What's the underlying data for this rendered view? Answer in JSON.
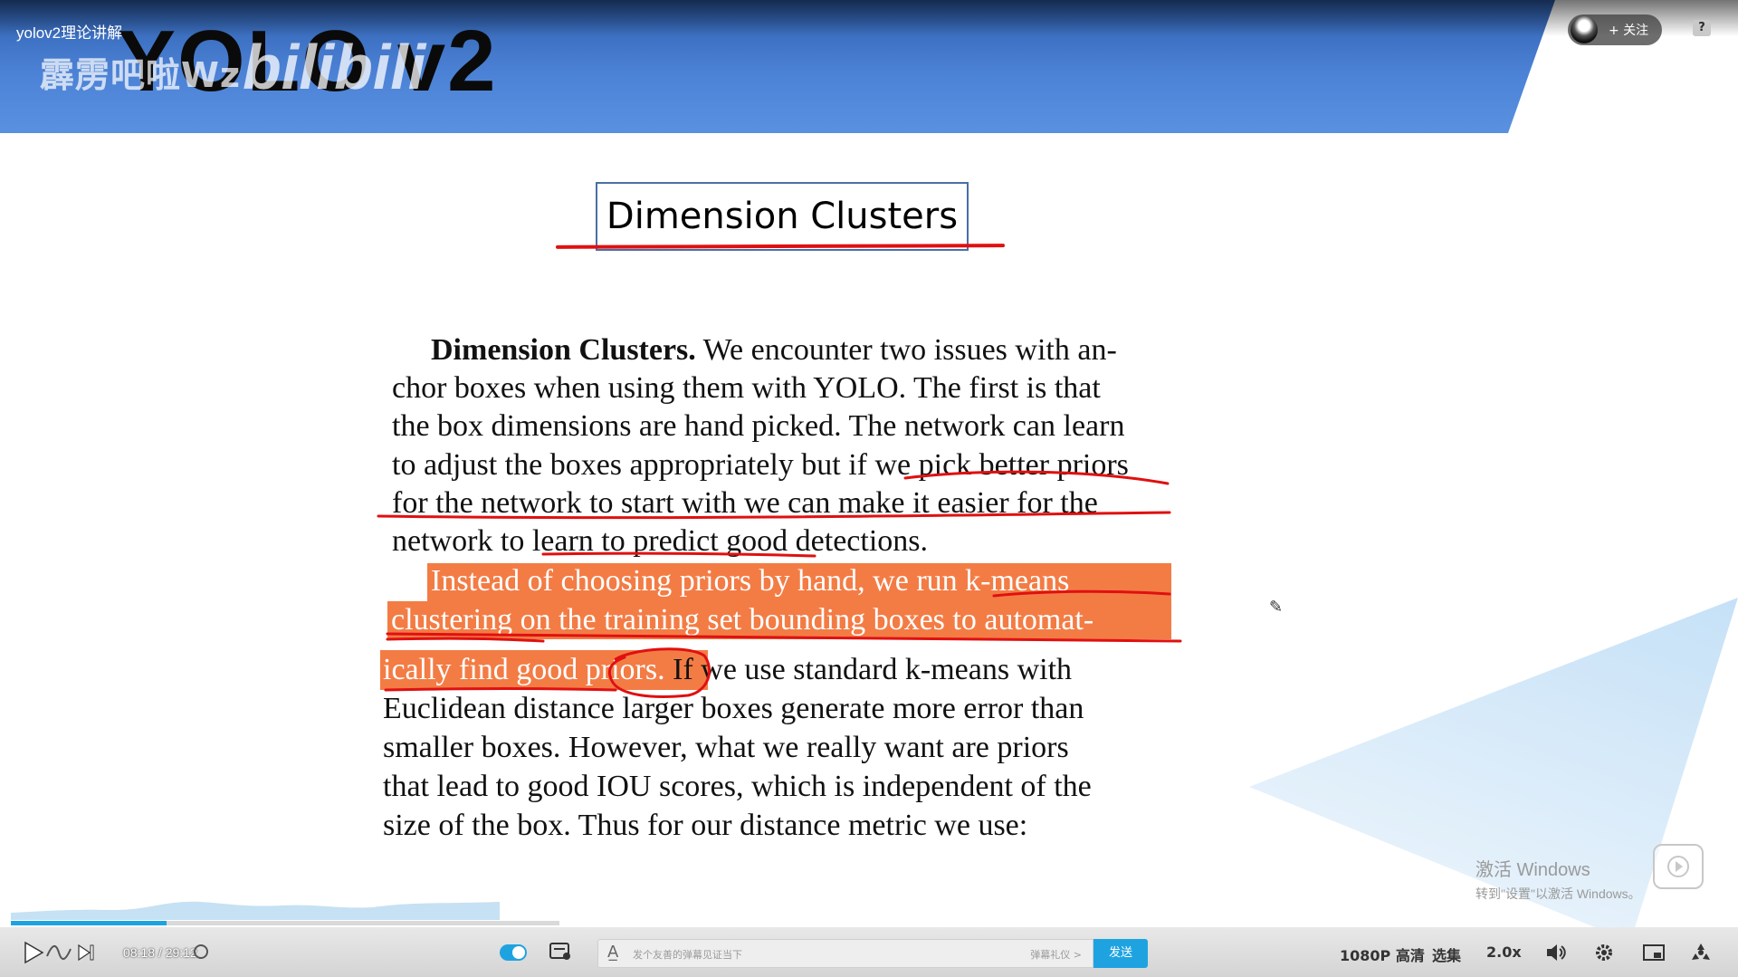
{
  "video": {
    "title": "yolov2理论讲解",
    "slide_heading": "YOLO v2",
    "watermark_name": "霹雳吧啦Wz",
    "watermark_logo": "bilibili"
  },
  "header": {
    "follow_label": "+ 关注",
    "help_symbol": "?"
  },
  "slide": {
    "section_title": "Dimension Clusters",
    "paragraph1": {
      "lead": "Dimension Clusters.",
      "line1_rest": " We encounter two issues with an-",
      "line2": "chor boxes when using them with YOLO. The first is that",
      "line3": "the box dimensions are hand picked. The network can learn",
      "line4": "to adjust the boxes appropriately but if we pick better priors",
      "line5": "for the network to start with we can make it easier for the",
      "line6": "network to learn to predict good detections."
    },
    "paragraph2": {
      "line1": "Instead of choosing priors by hand, we run k-means",
      "line2": "clustering on the training set bounding boxes to automat-",
      "line3_highlight": "ically find good priors.",
      "line3_rest": " If we use standard k-means with",
      "line4": "Euclidean distance larger boxes generate more error than",
      "line5": "smaller boxes.  However, what we really want are priors",
      "line6": "that lead to good IOU scores, which is independent of the",
      "line7": "size of the box. Thus for our distance metric we use:"
    },
    "highlight_color": "#f37c45",
    "ink_color": "#e01010"
  },
  "os_overlay": {
    "activate_line1": "激活 Windows",
    "activate_line2": "转到\"设置\"以激活 Windows。"
  },
  "player": {
    "current_time": "08:18",
    "separator": "/",
    "total_time": "29:12",
    "progress_fraction": 0.2842,
    "danmaku_placeholder": "发个友善的弹幕见证当下",
    "danmaku_etiquette": "弹幕礼仪 >",
    "send_label": "发送",
    "quality_label": "1080P 高清",
    "episodes_label": "选集",
    "speed_label": "2.0x",
    "accent_color": "#1fa3e0"
  }
}
